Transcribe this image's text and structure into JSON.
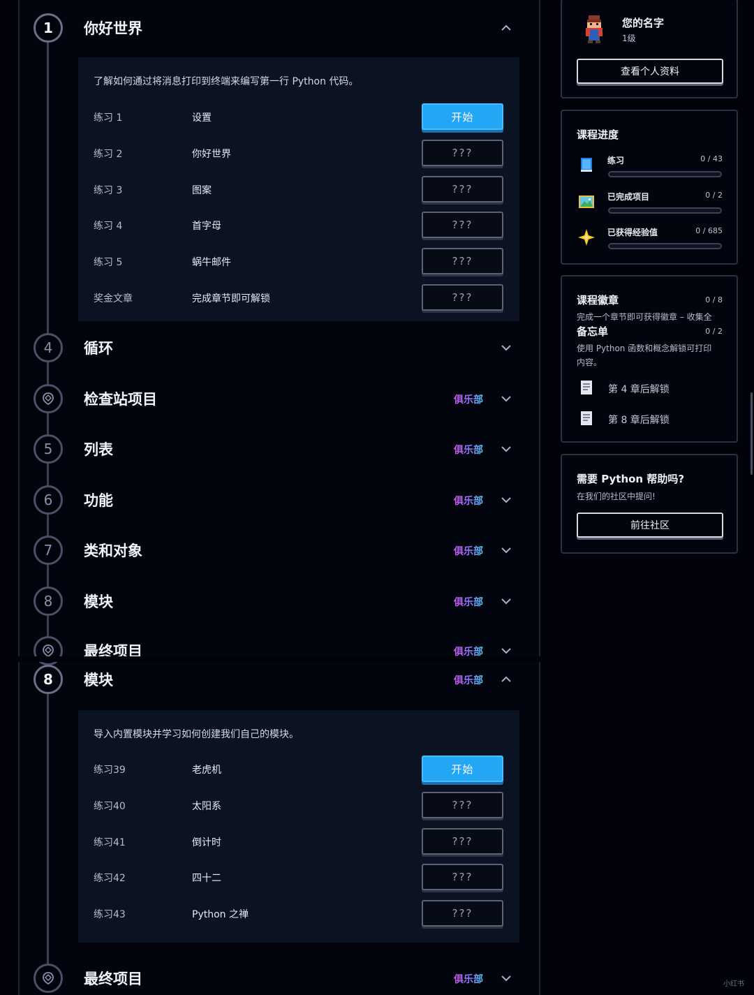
{
  "chapters_top": [
    {
      "num": "1",
      "title": "你好世界",
      "club": "",
      "expanded": true
    },
    {
      "num": "4",
      "title": "循环",
      "club": "",
      "expanded": false
    },
    {
      "num": "",
      "icon": "checkpoint-icon",
      "title": "检查站项目",
      "club": "俱乐部",
      "expanded": false
    },
    {
      "num": "5",
      "title": "列表",
      "club": "俱乐部",
      "expanded": false
    },
    {
      "num": "6",
      "title": "功能",
      "club": "俱乐部",
      "expanded": false
    },
    {
      "num": "7",
      "title": "类和对象",
      "club": "俱乐部",
      "expanded": false
    },
    {
      "num": "8",
      "title": "模块",
      "club": "俱乐部",
      "expanded": false
    },
    {
      "num": "",
      "icon": "checkpoint-icon",
      "title": "最终项目",
      "club": "俱乐部",
      "expanded": false
    }
  ],
  "chapter1": {
    "description": "了解如何通过将消息打印到终端来编写第一行 Python 代码。",
    "exercises": [
      {
        "num": "练习 1",
        "name": "设置",
        "button": "开始",
        "state": "start"
      },
      {
        "num": "练习 2",
        "name": "你好世界",
        "button": "???",
        "state": "locked"
      },
      {
        "num": "练习 3",
        "name": "图案",
        "button": "???",
        "state": "locked"
      },
      {
        "num": "练习 4",
        "name": "首字母",
        "button": "???",
        "state": "locked"
      },
      {
        "num": "练习 5",
        "name": "蜗牛邮件",
        "button": "???",
        "state": "locked"
      },
      {
        "num": "奖金文章",
        "name": "完成章节即可解锁",
        "button": "???",
        "state": "locked"
      }
    ]
  },
  "chapters_bottom": [
    {
      "num": "8",
      "title": "模块",
      "club": "俱乐部",
      "expanded": true
    },
    {
      "num": "",
      "icon": "checkpoint-icon",
      "title": "最终项目",
      "club": "俱乐部",
      "expanded": false
    }
  ],
  "chapter8": {
    "description": "导入内置模块并学习如何创建我们自己的模块。",
    "exercises": [
      {
        "num": "练习39",
        "name": "老虎机",
        "button": "开始",
        "state": "start"
      },
      {
        "num": "练习40",
        "name": "太阳系",
        "button": "???",
        "state": "locked"
      },
      {
        "num": "练习41",
        "name": "倒计时",
        "button": "???",
        "state": "locked"
      },
      {
        "num": "练习42",
        "name": "四十二",
        "button": "???",
        "state": "locked"
      },
      {
        "num": "练习43",
        "name": "Python 之禅",
        "button": "???",
        "state": "locked"
      }
    ]
  },
  "profile": {
    "name": "您的名字",
    "level": "1级",
    "button": "查看个人资料"
  },
  "progress": {
    "title": "课程进度",
    "items": [
      {
        "icon": "book-icon",
        "label": "练习",
        "value": "0 / 43",
        "fraction": 0
      },
      {
        "icon": "picture-icon",
        "label": "已完成项目",
        "value": "0 / 2",
        "fraction": 0
      },
      {
        "icon": "sparkle-icon",
        "label": "已获得经验值",
        "value": "0 / 685",
        "fraction": 0
      }
    ]
  },
  "badges": {
    "title": "课程徽章",
    "count": "0 / 8",
    "subtitle": "完成一个章节即可获得徽章 – 收集全",
    "cheatsheet_title": "备忘单",
    "cheatsheet_count": "0 / 2",
    "cheatsheet_desc_1": "使用 Python 函数和概念解锁可打印",
    "cheatsheet_desc_2": "内容。",
    "unlocks": [
      "第 4 章后解锁",
      "第 8 章后解锁"
    ]
  },
  "help": {
    "title": "需要 Python 帮助吗?",
    "subtitle": "在我们的社区中提问!",
    "button": "前往社区"
  },
  "watermark": "小红书",
  "colors": {
    "accent": "#23a7f5",
    "background": "#02030a",
    "panel": "#0b1221"
  }
}
